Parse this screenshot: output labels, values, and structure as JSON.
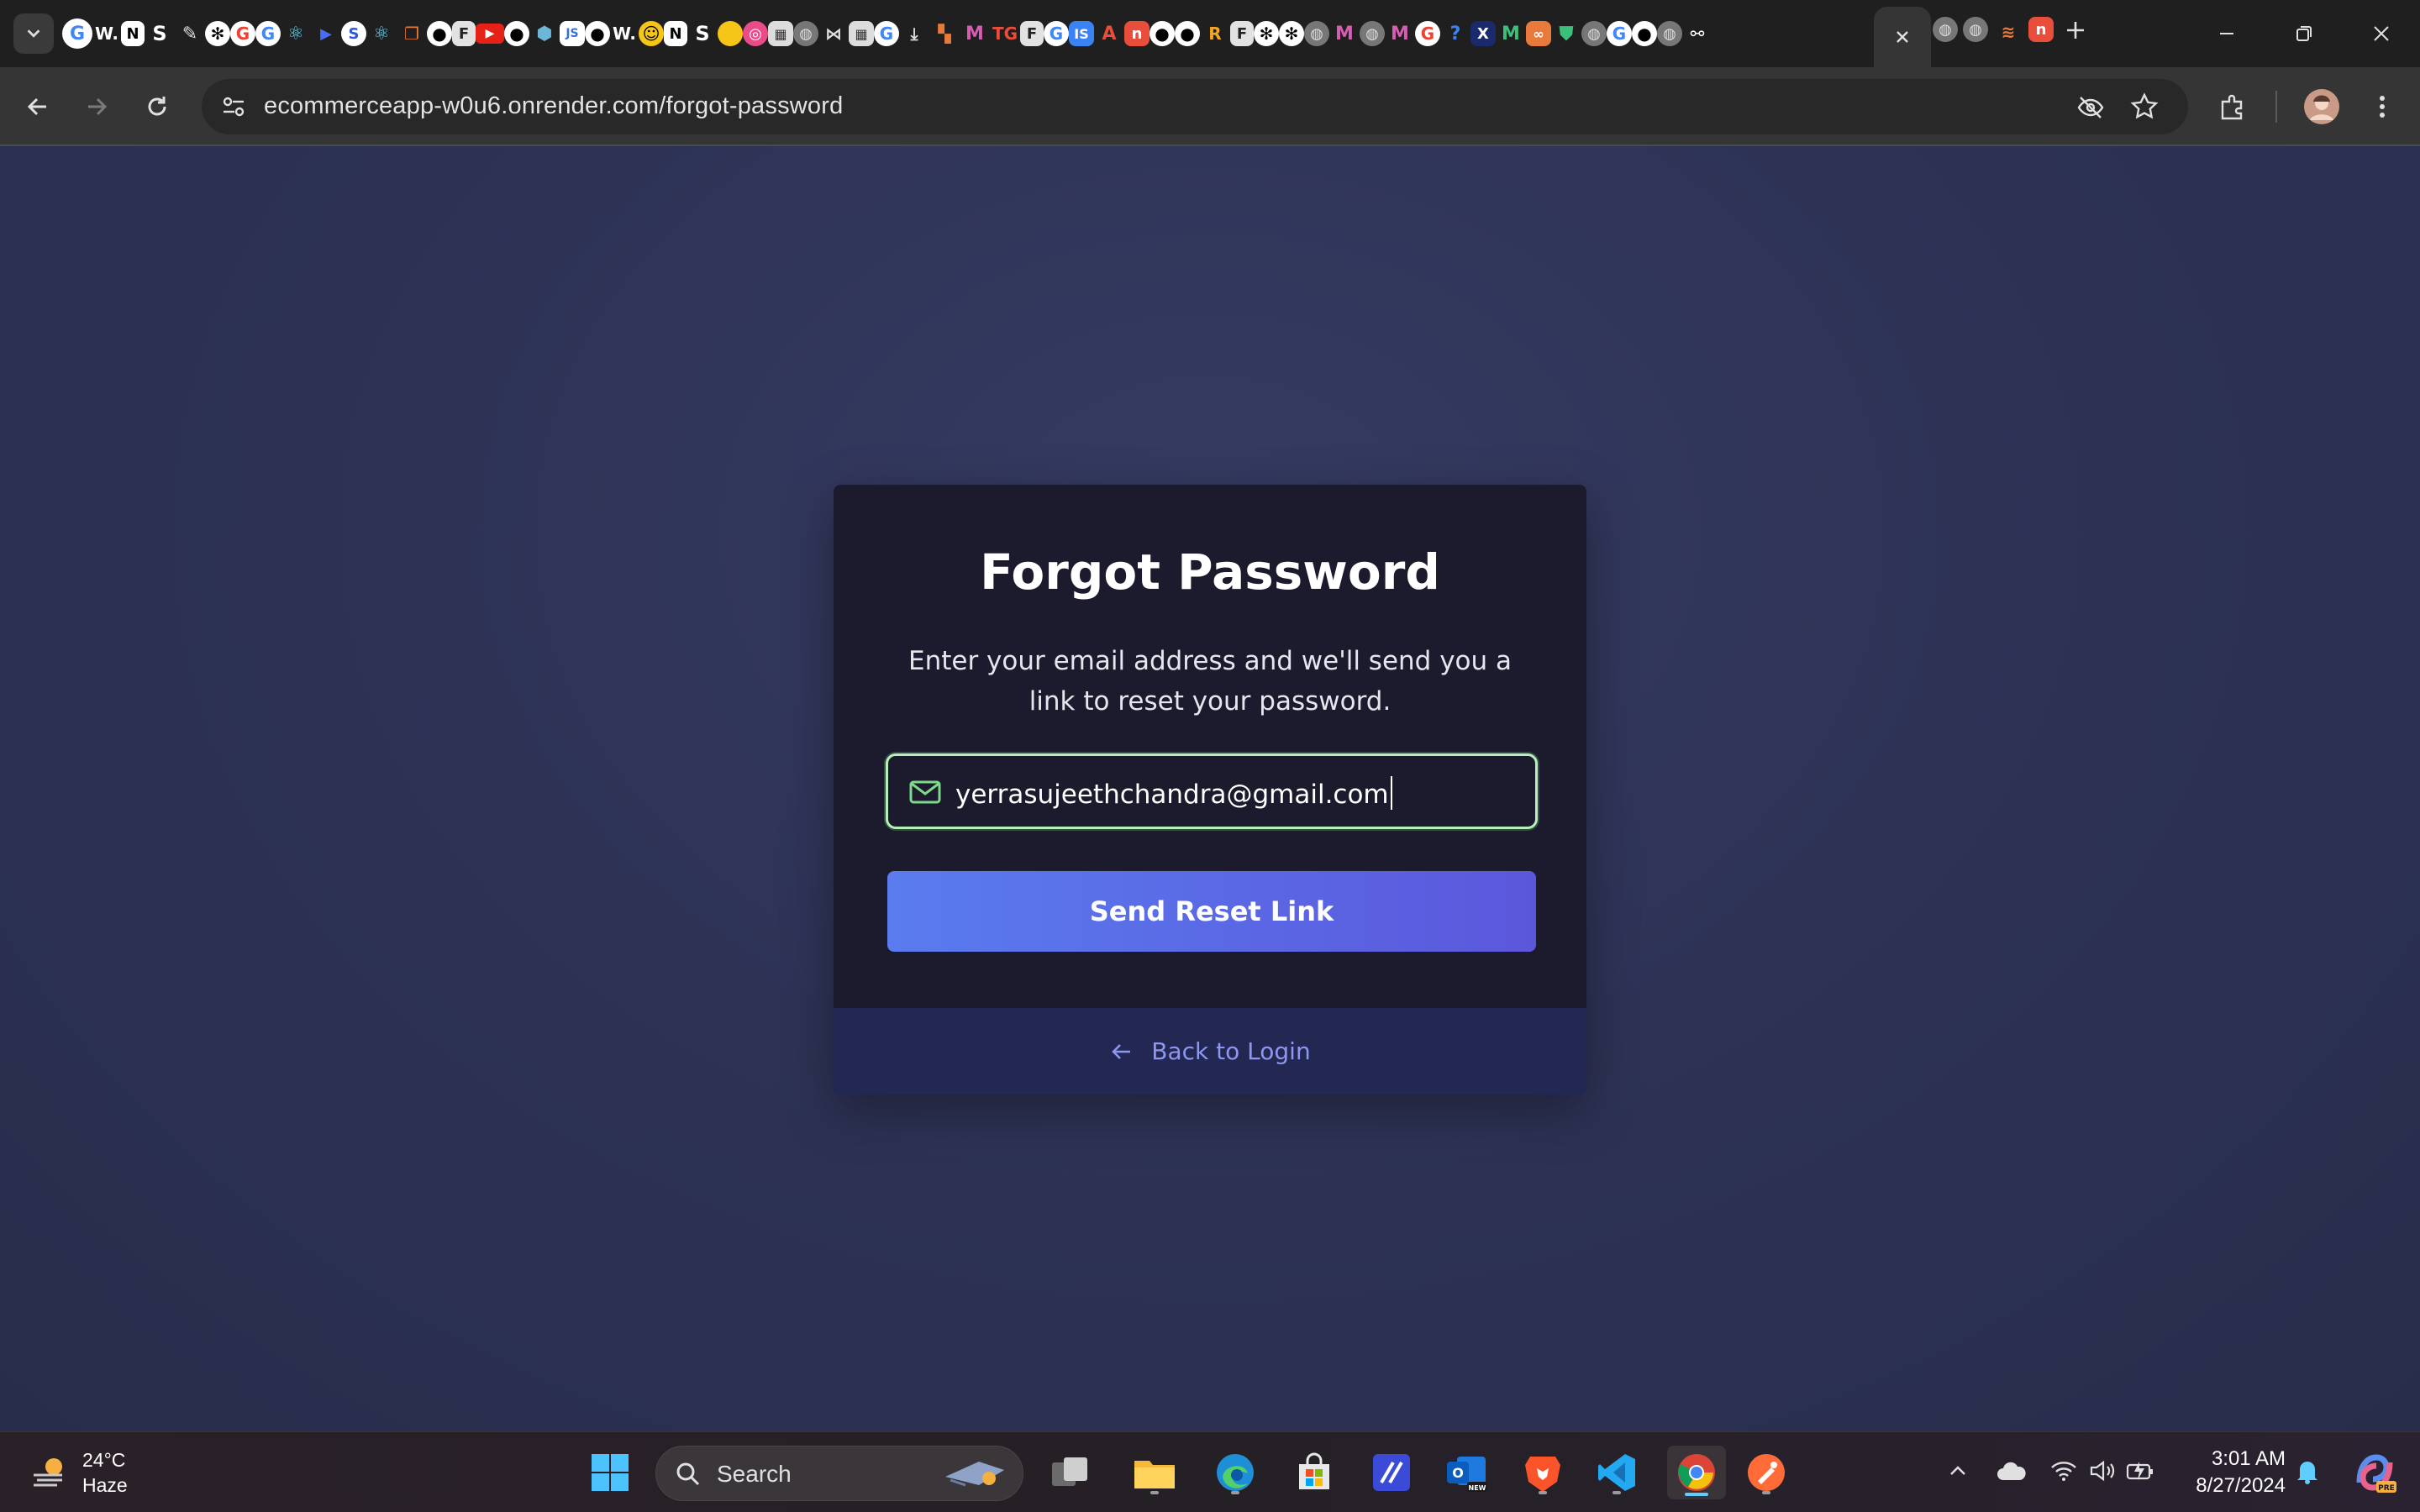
{
  "browser": {
    "url": "ecommerceapp-w0u6.onrender.com/forgot-password",
    "tab_letter_w": "W.",
    "tab_letter_s": "S"
  },
  "card": {
    "title": "Forgot Password",
    "description": "Enter your email address and we'll send you a link to reset your password.",
    "email_value": "yerrasujeethchandra@gmail.com",
    "submit_label": "Send Reset Link",
    "back_label": "Back to Login"
  },
  "taskbar": {
    "temperature": "24°C",
    "weather": "Haze",
    "search_placeholder": "Search",
    "time": "3:01 AM",
    "date": "8/27/2024"
  },
  "colors": {
    "accent_start": "#5a7cef",
    "accent_end": "#5b57dc",
    "focus_border": "#b6f0b8",
    "link": "#8d97f0"
  }
}
